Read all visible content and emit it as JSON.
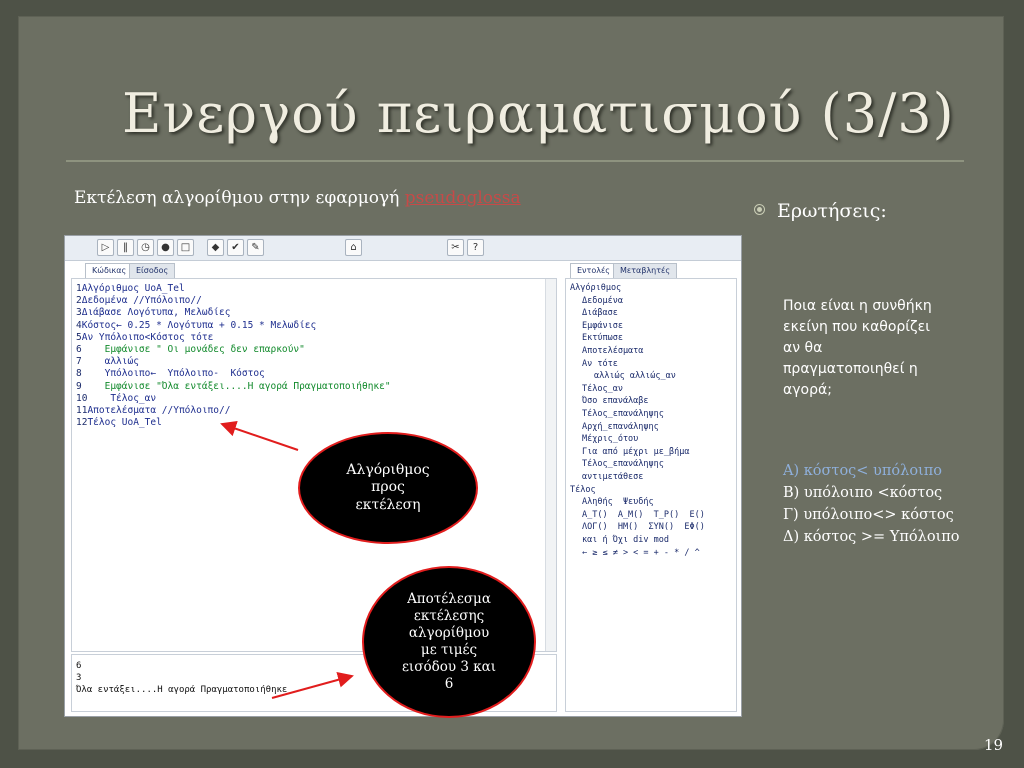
{
  "slide": {
    "title": "Ενεργού πειραματισμού (3/3)",
    "subtitle_prefix": "Εκτέλεση αλγορίθμου στην εφαρμογή",
    "subtitle_link": "pseudoglossa",
    "page_number": "19"
  },
  "app": {
    "editor_tabs": [
      "Κώδικας",
      "Είσοδος"
    ],
    "side_tabs": [
      "Εντολές",
      "Μεταβλητές"
    ],
    "toolbar_icons": [
      "run-icon",
      "step-icon",
      "timer-icon",
      "stop-icon",
      "square-icon",
      "open-icon",
      "save-icon",
      "export-icon",
      "home-icon",
      "settings-icon",
      "help-icon"
    ],
    "toolbar_glyphs": [
      "▷",
      "‖",
      "◷",
      "●",
      "□",
      "◆",
      "✔",
      "✎",
      "⌂",
      "✂",
      "?"
    ],
    "code_lines": [
      {
        "n": "1",
        "text": "Αλγόριθμος UoA_Tel",
        "cls": "kw"
      },
      {
        "n": "2",
        "text": "Δεδομένα //Υπόλοιπο//",
        "cls": "kw"
      },
      {
        "n": "3",
        "text": "Διάβασε Λογότυπα, Μελωδίες",
        "cls": "kw"
      },
      {
        "n": "4",
        "text": "Κόστος← 0.25 * Λογότυπα + 0.15 * Μελωδίες",
        "cls": "kw"
      },
      {
        "n": "5",
        "text": "Αν Υπόλοιπο<Κόστος τότε",
        "cls": "kw"
      },
      {
        "n": "6",
        "text": "    Εμφάνισε \" Οι μονάδες δεν επαρκούν\"",
        "cls": "str"
      },
      {
        "n": "7",
        "text": "    αλλιώς",
        "cls": "kw"
      },
      {
        "n": "8",
        "text": "    Υπόλοιπο←  Υπόλοιπο-  Κόστος",
        "cls": "kw"
      },
      {
        "n": "9",
        "text": "    Εμφάνισε \"Όλα εντάξει....Η αγορά Πραγματοποιήθηκε\"",
        "cls": "str"
      },
      {
        "n": "10",
        "text": "    Τέλος_αν",
        "cls": "kw"
      },
      {
        "n": "11",
        "text": "Αποτελέσματα //Υπόλοιπο//",
        "cls": "kw"
      },
      {
        "n": "12",
        "text": "Τέλος UoA_Tel",
        "cls": "kw"
      }
    ],
    "output_lines": [
      "6",
      "3",
      "Όλα εντάξει....Η αγορά Πραγματοποιήθηκε"
    ],
    "commands": [
      {
        "text": "Αλγόριθμος",
        "indent": 0
      },
      {
        "text": "Δεδομένα",
        "indent": 1
      },
      {
        "text": "Διάβασε",
        "indent": 1
      },
      {
        "text": "Εμφάνισε",
        "indent": 1
      },
      {
        "text": "Εκτύπωσε",
        "indent": 1
      },
      {
        "text": "Αποτελέσματα",
        "indent": 1
      },
      {
        "text": "Αν τότε",
        "indent": 1
      },
      {
        "text": "αλλιώς αλλιώς_αν",
        "indent": 2
      },
      {
        "text": "Τέλος_αν",
        "indent": 1
      },
      {
        "text": "Όσο επανάλαβε",
        "indent": 1
      },
      {
        "text": "Τέλος_επανάληψης",
        "indent": 1
      },
      {
        "text": "Αρχή_επανάληψης",
        "indent": 1
      },
      {
        "text": "Μέχρις_ότου",
        "indent": 1
      },
      {
        "text": "Για από μέχρι με_βήμα",
        "indent": 1
      },
      {
        "text": "Τέλος_επανάληψης",
        "indent": 1
      },
      {
        "text": "αντιμετάθεσε",
        "indent": 1
      },
      {
        "text": "Τέλος",
        "indent": 0
      },
      {
        "text": "Αληθής  Ψευδής",
        "indent": 1
      },
      {
        "text": "Α_Τ()  Α_Μ()  Τ_Ρ()  Ε()",
        "indent": 1
      },
      {
        "text": "ΛΟΓ()  ΗΜ()  ΣΥΝ()  ΕΦ()",
        "indent": 1
      },
      {
        "text": "και ή Όχι div mod",
        "indent": 1
      },
      {
        "text": "← ≥ ≤ ≠ > < = + - * / ^",
        "indent": 1
      }
    ]
  },
  "annotations": {
    "algorithm_bubble": [
      "Αλγόριθμος",
      "προς",
      "εκτέλεση"
    ],
    "result_bubble": [
      "Αποτέλεσμα",
      "εκτέλεσης",
      "αλγορίθμου",
      "με τιμές",
      "εισόδου 3 και",
      "6"
    ]
  },
  "right": {
    "heading": "Ερωτήσεις:",
    "question_lines": [
      "Ποια είναι η συνθήκη",
      "εκείνη που καθορίζει",
      "αν θα",
      "πραγματοποιηθεί η",
      "αγορά;"
    ],
    "answers": [
      "Α) κόστος< υπόλοιπο",
      "Β) υπόλοιπο <κόστος",
      "Γ) υπόλοιπο<> κόστος",
      "Δ) κόστος >= Υπόλοιπο"
    ]
  },
  "colors": {
    "background": "#6c6f62",
    "highlight_answer": "#8fb0dc",
    "link": "#c64a48"
  }
}
